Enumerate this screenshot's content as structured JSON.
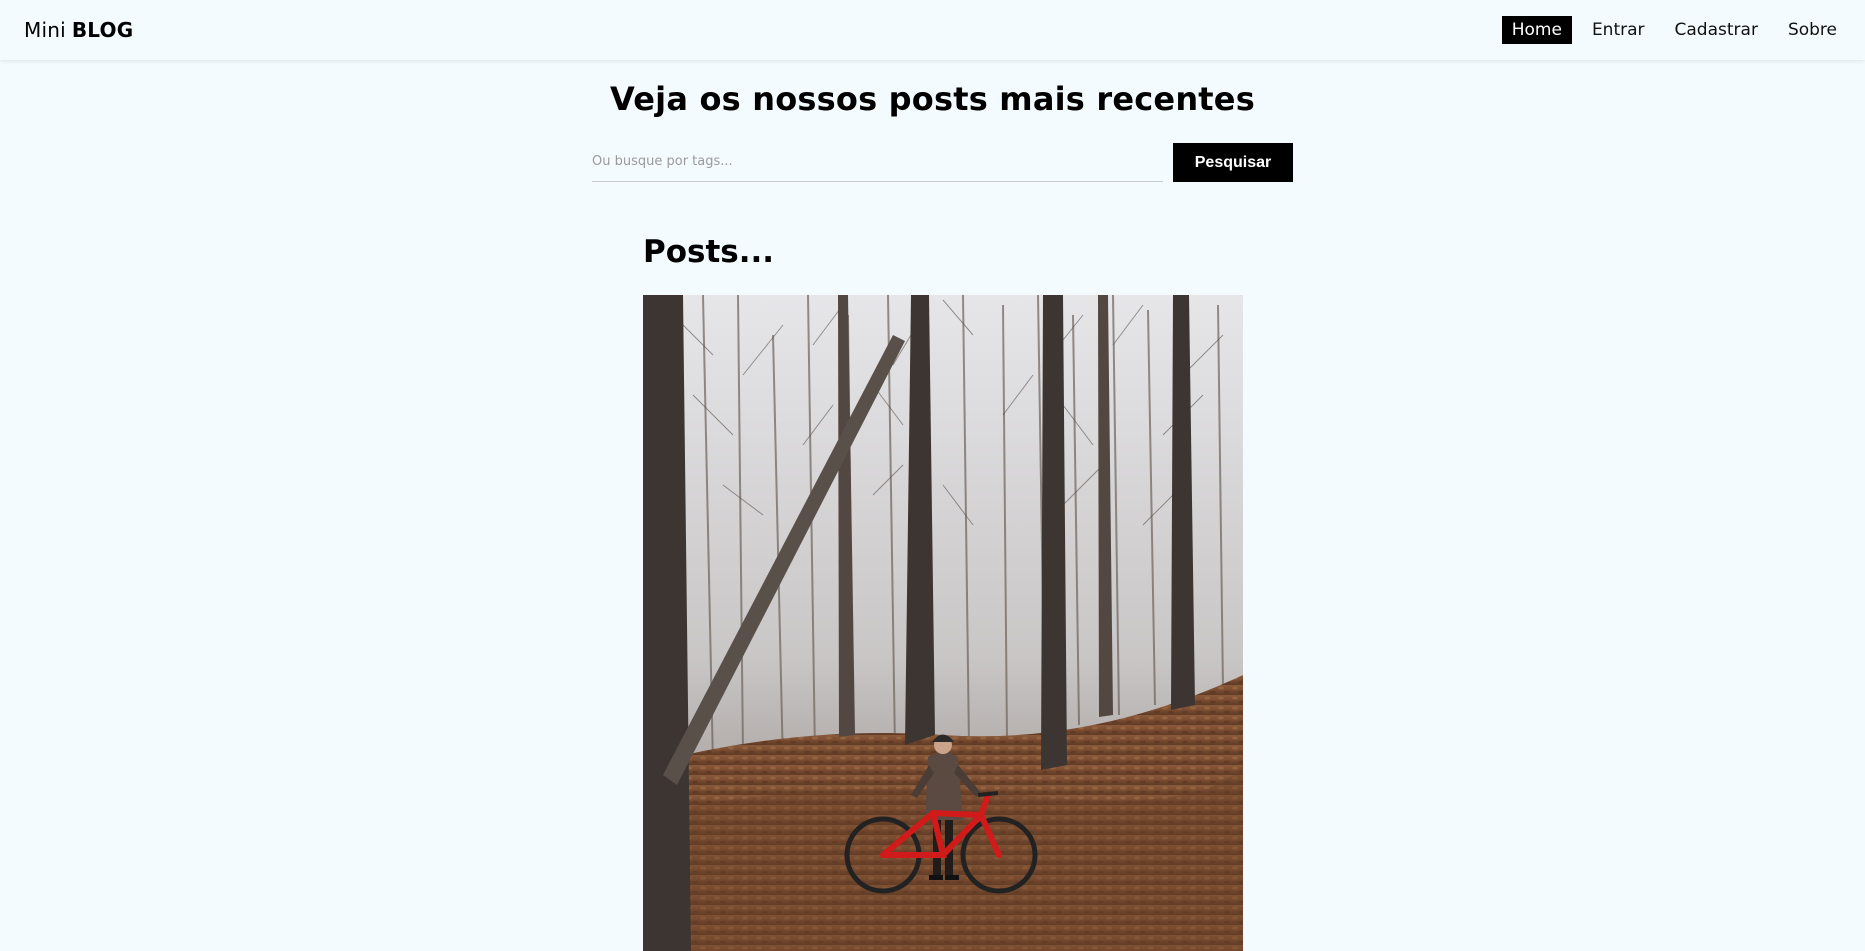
{
  "navbar": {
    "brand_prefix": "Mini",
    "brand_strong": "BLOG",
    "links": [
      {
        "label": "Home",
        "active": true
      },
      {
        "label": "Entrar",
        "active": false
      },
      {
        "label": "Cadastrar",
        "active": false
      },
      {
        "label": "Sobre",
        "active": false
      }
    ]
  },
  "hero": {
    "title": "Veja os nossos posts mais recentes"
  },
  "search": {
    "placeholder": "Ou busque por tags...",
    "value": "",
    "button_label": "Pesquisar"
  },
  "posts": {
    "heading": "Posts..."
  },
  "colors": {
    "background": "#f3fbff",
    "accent": "#000000"
  }
}
